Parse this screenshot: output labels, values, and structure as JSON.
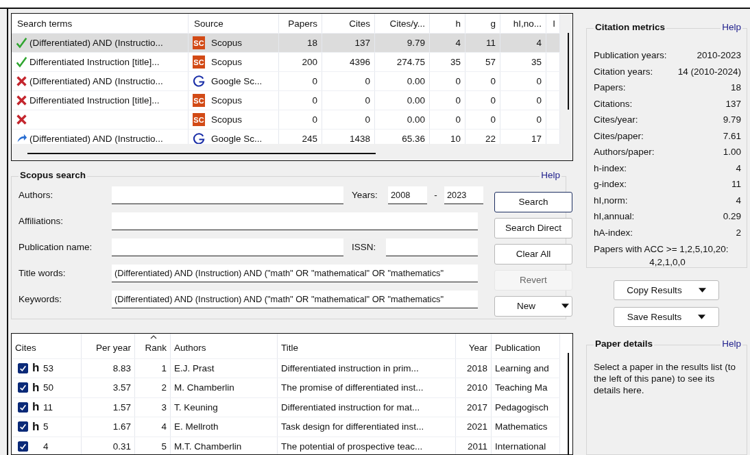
{
  "queries": {
    "columns": [
      "Search terms",
      "Source",
      "Papers",
      "Cites",
      "Cites/y...",
      "h",
      "g",
      "hI,no...",
      "I"
    ],
    "rows": [
      {
        "kind": "ok",
        "selected": true,
        "badge": "SC",
        "cells": [
          "(Differentiated) AND (Instructio...",
          "Scopus",
          "18",
          "137",
          "9.79",
          "4",
          "11",
          "4"
        ]
      },
      {
        "kind": "ok",
        "selected": false,
        "badge": "SC",
        "cells": [
          "Differentiated Instruction [title]...",
          "Scopus",
          "200",
          "4396",
          "274.75",
          "35",
          "57",
          "35"
        ]
      },
      {
        "kind": "failed",
        "selected": false,
        "cells": [
          "(Differentiated) AND (Instructio...",
          "Google Sc...",
          "0",
          "0",
          "0.00",
          "0",
          "0",
          "0"
        ]
      },
      {
        "kind": "failed",
        "selected": false,
        "badge": "SC",
        "cells": [
          "Differentiated Instruction [title]...",
          "Scopus",
          "0",
          "0",
          "0.00",
          "0",
          "0",
          "0"
        ]
      },
      {
        "kind": "failed",
        "selected": false,
        "badge": "SC",
        "cells": [
          "",
          "Scopus",
          "0",
          "0",
          "0.00",
          "0",
          "0",
          "0"
        ]
      },
      {
        "kind": "pending",
        "selected": false,
        "cells": [
          "(Differentiated) AND (Instructio...",
          "Google Sc...",
          "245",
          "1438",
          "65.36",
          "10",
          "22",
          "17"
        ]
      }
    ]
  },
  "search": {
    "title": "Scopus search",
    "help": "Help",
    "authors": {
      "label": "Authors:"
    },
    "years": {
      "label": "Years:",
      "from": "2008",
      "separator": "-",
      "to": "2023"
    },
    "affiliations": {
      "label": "Affiliations:"
    },
    "publication": {
      "label": "Publication name:"
    },
    "issn": {
      "label": "ISSN:"
    },
    "title_words": {
      "label": "Title words:",
      "value": "(Differentiated) AND (Instruction) AND (\"math\" OR \"mathematical\" OR \"mathematics\""
    },
    "keywords": {
      "label": "Keywords:",
      "value": "(Differentiated) AND (Instruction) AND (\"math\" OR \"mathematical\" OR \"mathematics\""
    },
    "buttons": [
      {
        "label": "Search",
        "focused": true,
        "disabled": false,
        "dropdown": false
      },
      {
        "label": "Search Direct",
        "focused": false,
        "disabled": false,
        "dropdown": false
      },
      {
        "label": "Clear All",
        "focused": false,
        "disabled": false,
        "dropdown": false
      },
      {
        "label": "Revert",
        "focused": false,
        "disabled": true,
        "dropdown": false
      },
      {
        "label": "New",
        "focused": false,
        "disabled": false,
        "dropdown": true
      }
    ]
  },
  "results": {
    "columns": [
      {
        "label": "Cites",
        "sorted": false
      },
      {
        "label": "Per year",
        "sorted": false
      },
      {
        "label": "Rank",
        "sorted": true
      },
      {
        "label": "Authors",
        "sorted": false
      },
      {
        "label": "Title",
        "sorted": false
      },
      {
        "label": "Year",
        "sorted": false
      },
      {
        "label": "Publication",
        "sorted": false
      }
    ],
    "rows": [
      {
        "checked": true,
        "marker": "h",
        "cites": "53",
        "per_year": "8.83",
        "rank": "1",
        "authors": "E.J. Prast",
        "title": "Differentiated instruction in prim...",
        "year": "2018",
        "publication": "Learning and"
      },
      {
        "checked": true,
        "marker": "h",
        "cites": "50",
        "per_year": "3.57",
        "rank": "2",
        "authors": "M. Chamberlin",
        "title": "The promise of differentiated inst...",
        "year": "2010",
        "publication": "Teaching Ma"
      },
      {
        "checked": true,
        "marker": "h",
        "cites": "11",
        "per_year": "1.57",
        "rank": "3",
        "authors": "T. Keuning",
        "title": "Differentiated instruction for mat...",
        "year": "2017",
        "publication": "Pedagogisch"
      },
      {
        "checked": true,
        "marker": "h",
        "cites": "5",
        "per_year": "1.67",
        "rank": "4",
        "authors": "E. Mellroth",
        "title": "Task design for differentiated inst...",
        "year": "2021",
        "publication": "Mathematics"
      },
      {
        "checked": true,
        "cites": "4",
        "per_year": "0.31",
        "rank": "5",
        "authors": "M.T. Chamberlin",
        "title": "The potential of prospective teac...",
        "year": "2011",
        "publication": "International"
      }
    ]
  },
  "metrics": {
    "title": "Citation metrics",
    "help": "Help",
    "items": [
      {
        "label": "Publication years:",
        "value": "2010-2023"
      },
      {
        "label": "Citation years:",
        "value": "14 (2010-2024)"
      },
      {
        "label": "Papers:",
        "value": "18"
      },
      {
        "label": "Citations:",
        "value": "137"
      },
      {
        "label": "Cites/year:",
        "value": "9.79"
      },
      {
        "label": "Cites/paper:",
        "value": "7.61"
      },
      {
        "label": "Authors/paper:",
        "value": "1.00"
      },
      {
        "label": "h-index:",
        "value": "4"
      },
      {
        "label": "g-index:",
        "value": "11"
      },
      {
        "label": "hI,norm:",
        "value": "4"
      },
      {
        "label": "hI,annual:",
        "value": "0.29"
      },
      {
        "label": "hA-index:",
        "value": "2"
      }
    ],
    "acc_label": "Papers with ACC >= 1,2,5,10,20:",
    "acc_value": "4,2,1,0,0"
  },
  "actions": [
    "Copy Results",
    "Save Results"
  ],
  "details": {
    "title": "Paper details",
    "help": "Help",
    "text": "Select a paper in the results list (to the left of this pane) to see its details here."
  }
}
